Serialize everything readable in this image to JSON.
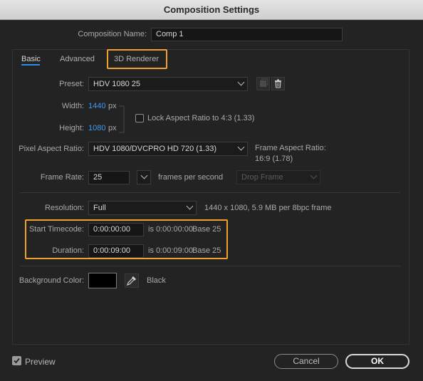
{
  "window": {
    "title": "Composition Settings"
  },
  "composition_name": {
    "label": "Composition Name:",
    "value": "Comp 1"
  },
  "tabs": [
    {
      "label": "Basic",
      "active": true
    },
    {
      "label": "Advanced",
      "active": false
    },
    {
      "label": "3D Renderer",
      "active": false
    }
  ],
  "preset": {
    "label": "Preset:",
    "value": "HDV 1080 25"
  },
  "width": {
    "label": "Width:",
    "value": "1440",
    "unit": "px"
  },
  "height": {
    "label": "Height:",
    "value": "1080",
    "unit": "px"
  },
  "lock_aspect": {
    "label": "Lock Aspect Ratio to 4:3 (1.33)",
    "checked": false
  },
  "pixel_aspect": {
    "label": "Pixel Aspect Ratio:",
    "value": "HDV 1080/DVCPRO HD 720 (1.33)"
  },
  "frame_aspect": {
    "line1": "Frame Aspect Ratio:",
    "line2": "16:9 (1.78)"
  },
  "frame_rate": {
    "label": "Frame Rate:",
    "value": "25",
    "unit": "frames per second",
    "drop_frame": "Drop Frame"
  },
  "resolution": {
    "label": "Resolution:",
    "value": "Full",
    "info": "1440 x 1080, 5.9 MB per 8bpc frame"
  },
  "start_timecode": {
    "label": "Start Timecode:",
    "value": "0:00:00:00",
    "info": "is 0:00:00:00",
    "base": "Base 25"
  },
  "duration": {
    "label": "Duration:",
    "value": "0:00:09:00",
    "info": "is 0:00:09:00",
    "base": "Base 25"
  },
  "background_color": {
    "label": "Background Color:",
    "name": "Black",
    "hex": "#000000"
  },
  "footer": {
    "preview_label": "Preview",
    "preview_checked": true,
    "cancel_label": "Cancel",
    "ok_label": "OK"
  },
  "colors": {
    "accent": "#2d8ceb",
    "highlight": "#f0a12a",
    "value_blue": "#3b9cf5"
  }
}
